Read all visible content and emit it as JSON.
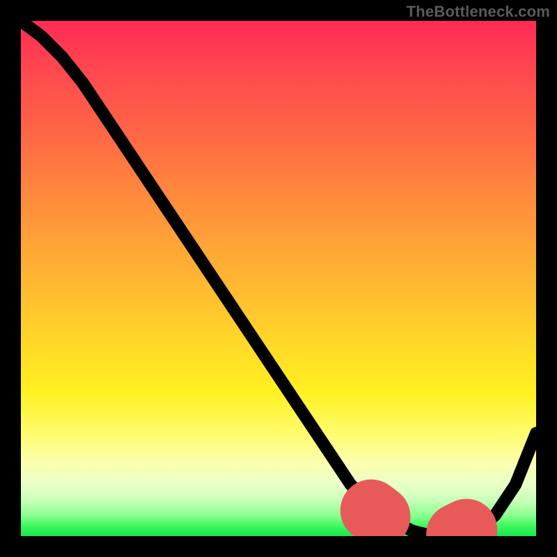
{
  "watermark": "TheBottleneck.com",
  "colors": {
    "background": "#000000",
    "curve": "#000000",
    "highlight": "#e85a5a"
  },
  "chart_data": {
    "type": "line",
    "title": "",
    "xlabel": "",
    "ylabel": "",
    "xlim": [
      0,
      100
    ],
    "ylim": [
      0,
      100
    ],
    "grid": false,
    "legend": false,
    "gradient_stops": [
      {
        "pos": 0,
        "color": "#ff2a55"
      },
      {
        "pos": 22,
        "color": "#ff6745"
      },
      {
        "pos": 48,
        "color": "#ffb034"
      },
      {
        "pos": 72,
        "color": "#fff020"
      },
      {
        "pos": 90,
        "color": "#e9ffc8"
      },
      {
        "pos": 100,
        "color": "#17e84c"
      }
    ],
    "series": [
      {
        "name": "bottleneck-curve",
        "x": [
          0,
          4,
          8,
          12,
          16,
          20,
          24,
          28,
          32,
          36,
          40,
          44,
          48,
          52,
          56,
          60,
          64,
          68,
          72,
          76,
          80,
          84,
          88,
          92,
          96,
          100
        ],
        "values": [
          100,
          97,
          93,
          88,
          82,
          76,
          70,
          64,
          58,
          52,
          46,
          40,
          34,
          28,
          22,
          16,
          10,
          6,
          3,
          1,
          0,
          0,
          1,
          4,
          10,
          20
        ]
      },
      {
        "name": "optimal-range-highlight",
        "x": [
          68,
          72,
          76,
          80,
          84,
          88
        ],
        "values": [
          5,
          2,
          1,
          0,
          0,
          2
        ]
      }
    ],
    "annotations": []
  }
}
